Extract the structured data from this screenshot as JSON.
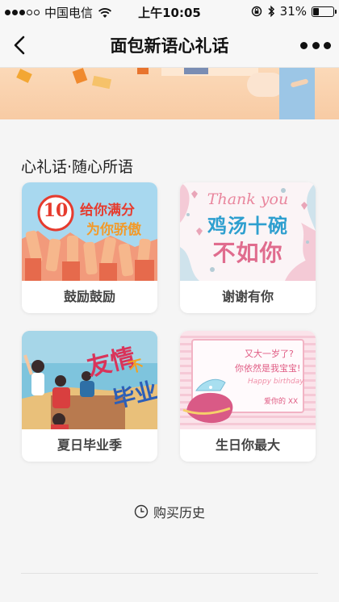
{
  "status_bar": {
    "carrier": "中国电信",
    "time": "上午10:05",
    "battery_percent": "31%",
    "battery_level": 0.31,
    "signal_bars_filled": 3,
    "signal_bars_total": 5
  },
  "nav": {
    "title": "面包新语心礼话",
    "back_icon": "chevron-left-icon",
    "more_icon": "more-dots-icon"
  },
  "section": {
    "title": "心礼话·随心所语"
  },
  "cards": [
    {
      "label": "鼓励鼓励",
      "art_badge": "10",
      "art_line1": "给你满分",
      "art_line2": "为你骄傲"
    },
    {
      "label": "谢谢有你",
      "art_line1": "Thank you",
      "art_line2": "鸡汤十碗",
      "art_line3": "不如你"
    },
    {
      "label": "夏日毕业季",
      "art_line1": "友情",
      "art_line2": "不",
      "art_line3": "毕业"
    },
    {
      "label": "生日你最大",
      "art_line1": "又大一岁了?",
      "art_line2": "你依然是我宝宝!",
      "art_line3": "Happy birthday",
      "art_line4": "爱你的 XX"
    }
  ],
  "history": {
    "label": "购买历史",
    "icon": "clock-icon"
  },
  "colors": {
    "accent_orange": "#f39a28",
    "banner_bg": "#f8cba4",
    "card_pink": "#f6c9d3",
    "sky_blue": "#9fd3e8"
  }
}
